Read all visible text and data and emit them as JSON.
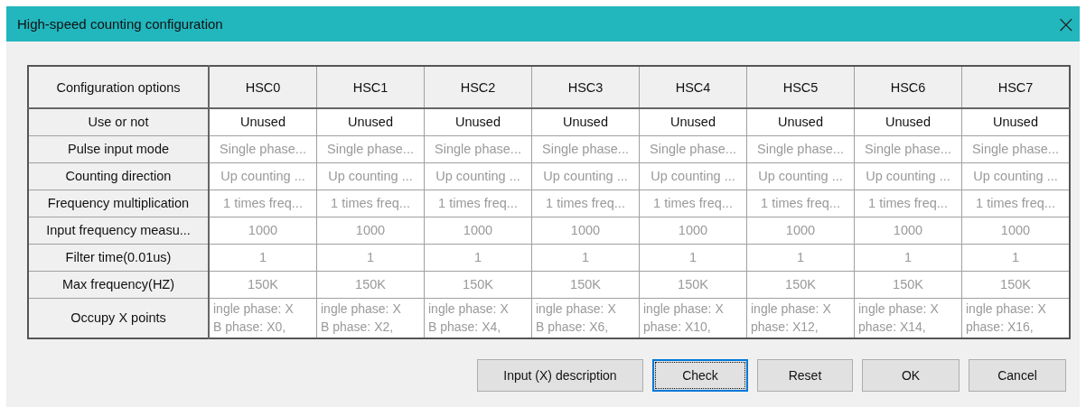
{
  "window": {
    "title": "High-speed counting configuration",
    "close": "×"
  },
  "table": {
    "corner": "Configuration options",
    "columns": [
      "HSC0",
      "HSC1",
      "HSC2",
      "HSC3",
      "HSC4",
      "HSC5",
      "HSC6",
      "HSC7"
    ],
    "rows": [
      {
        "label": "Use or not",
        "disabled": false,
        "cells": [
          "Unused",
          "Unused",
          "Unused",
          "Unused",
          "Unused",
          "Unused",
          "Unused",
          "Unused"
        ]
      },
      {
        "label": "Pulse input mode",
        "disabled": true,
        "cells": [
          "Single phase...",
          "Single phase...",
          "Single phase...",
          "Single phase...",
          "Single phase...",
          "Single phase...",
          "Single phase...",
          "Single phase..."
        ]
      },
      {
        "label": "Counting direction",
        "disabled": true,
        "cells": [
          "Up counting ...",
          "Up counting ...",
          "Up counting ...",
          "Up counting ...",
          "Up counting ...",
          "Up counting ...",
          "Up counting ...",
          "Up counting ..."
        ]
      },
      {
        "label": "Frequency multiplication",
        "disabled": true,
        "cells": [
          "1 times freq...",
          "1 times freq...",
          "1 times freq...",
          "1 times freq...",
          "1 times freq...",
          "1 times freq...",
          "1 times freq...",
          "1 times freq..."
        ]
      },
      {
        "label": "Input frequency measu...",
        "disabled": true,
        "cells": [
          "1000",
          "1000",
          "1000",
          "1000",
          "1000",
          "1000",
          "1000",
          "1000"
        ]
      },
      {
        "label": "Filter time(0.01us)",
        "disabled": true,
        "cells": [
          "1",
          "1",
          "1",
          "1",
          "1",
          "1",
          "1",
          "1"
        ]
      },
      {
        "label": "Max frequency(HZ)",
        "disabled": true,
        "cells": [
          "150K",
          "150K",
          "150K",
          "150K",
          "150K",
          "150K",
          "150K",
          "150K"
        ]
      },
      {
        "label": "Occupy X points",
        "disabled": true,
        "kind": "multiline",
        "cells": [
          [
            "ingle phase: X",
            "B phase: X0,"
          ],
          [
            "ingle phase: X",
            "B phase: X2,"
          ],
          [
            "ingle phase: X",
            "B phase: X4,"
          ],
          [
            "ingle phase: X",
            "B phase: X6,"
          ],
          [
            "ingle phase: X",
            "phase: X10,"
          ],
          [
            "ingle phase: X",
            "phase: X12,"
          ],
          [
            "ingle phase: X",
            "phase: X14,"
          ],
          [
            "ingle phase: X",
            "phase: X16,"
          ]
        ]
      }
    ]
  },
  "buttons": [
    {
      "label": "Input (X) description",
      "focused": false
    },
    {
      "label": "Check",
      "focused": true
    },
    {
      "label": "Reset",
      "focused": false
    },
    {
      "label": "OK",
      "focused": false
    },
    {
      "label": "Cancel",
      "focused": false
    }
  ]
}
